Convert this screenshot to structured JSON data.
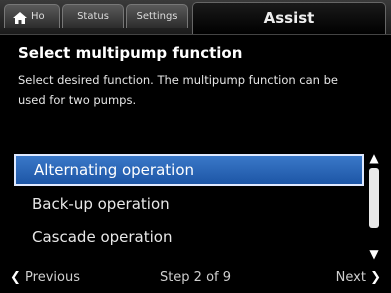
{
  "tabs": {
    "home": "Ho",
    "status": "Status",
    "settings": "Settings",
    "assist": "Assist"
  },
  "screen": {
    "title": "Select multipump function",
    "description": "Select desired function. The multipump function can be used for two pumps."
  },
  "options": {
    "items": [
      {
        "label": "Alternating operation",
        "selected": true
      },
      {
        "label": "Back-up operation",
        "selected": false
      },
      {
        "label": "Cascade operation",
        "selected": false
      }
    ]
  },
  "footer": {
    "previous": "Previous",
    "step": "Step 2 of 9",
    "next": "Next"
  },
  "colors": {
    "accent": "#2a66b8",
    "background": "#000000"
  }
}
